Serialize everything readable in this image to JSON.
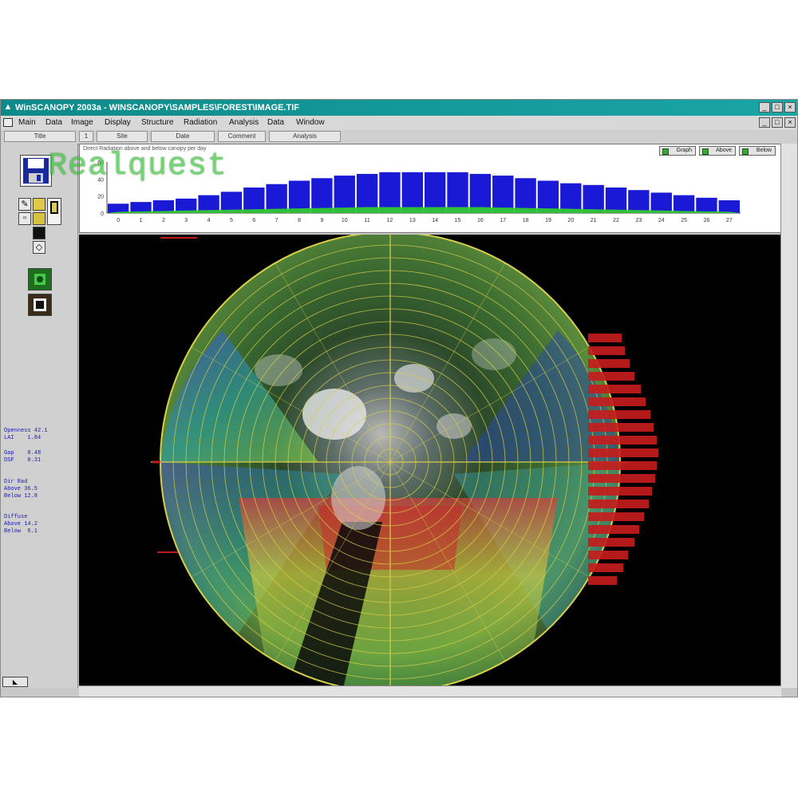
{
  "window": {
    "title": "WinSCANOPY 2003a - WINSCANOPY\\SAMPLES\\FOREST\\IMAGE.TIF"
  },
  "menubar": {
    "items": [
      "Main",
      "Data",
      "Image",
      "Display",
      "Structure",
      "Radiation",
      "Analysis",
      "Data",
      "Window"
    ]
  },
  "toolbar": {
    "fields": [
      "Title",
      "1",
      "Site",
      "Date",
      "Comment",
      "Analysis"
    ]
  },
  "chart_panel": {
    "title": "Direct Radiation above and below canopy per day",
    "legend": [
      "Graph",
      "Above",
      "Below"
    ]
  },
  "watermark": "Realquest",
  "stats": {
    "block1": "Openness 42.1\nLAI    1.84",
    "block2": "Gap    0.48\nDSF    0.31",
    "block3": "Dir Rad\nAbove 36.5\nBelow 12.8",
    "block4": "Diffuse\nAbove 14.2\nBelow  6.1"
  },
  "chart_data": {
    "type": "bar",
    "categories": [
      "0",
      "1",
      "2",
      "3",
      "4",
      "5",
      "6",
      "7",
      "8",
      "9",
      "10",
      "11",
      "12",
      "13",
      "14",
      "15",
      "16",
      "17",
      "18",
      "19",
      "20",
      "21",
      "22",
      "23",
      "24",
      "25",
      "26",
      "27"
    ],
    "series": [
      {
        "values": [
          11,
          13,
          15,
          17,
          21,
          25,
          30,
          34,
          38,
          41,
          44,
          46,
          48,
          48,
          48,
          48,
          46,
          44,
          41,
          38,
          35,
          33,
          30,
          27,
          24,
          21,
          18,
          15
        ]
      },
      {
        "values": [
          1.5,
          2,
          2.5,
          3,
          3.5,
          4,
          4.5,
          5,
          5.5,
          6,
          6.5,
          7,
          7,
          7,
          7,
          7,
          7,
          6.5,
          6,
          5.5,
          5,
          4.5,
          4,
          3.5,
          3,
          2.5,
          2,
          1.5
        ]
      }
    ],
    "ylim": [
      0,
      60
    ],
    "colors": {
      "above": "#1a1ad6",
      "below": "#33c733"
    }
  },
  "colors": {
    "titlebar": "#139a9a",
    "grid": "#d8cf4a",
    "histogram": "#c41c1c",
    "background": "#000000"
  }
}
